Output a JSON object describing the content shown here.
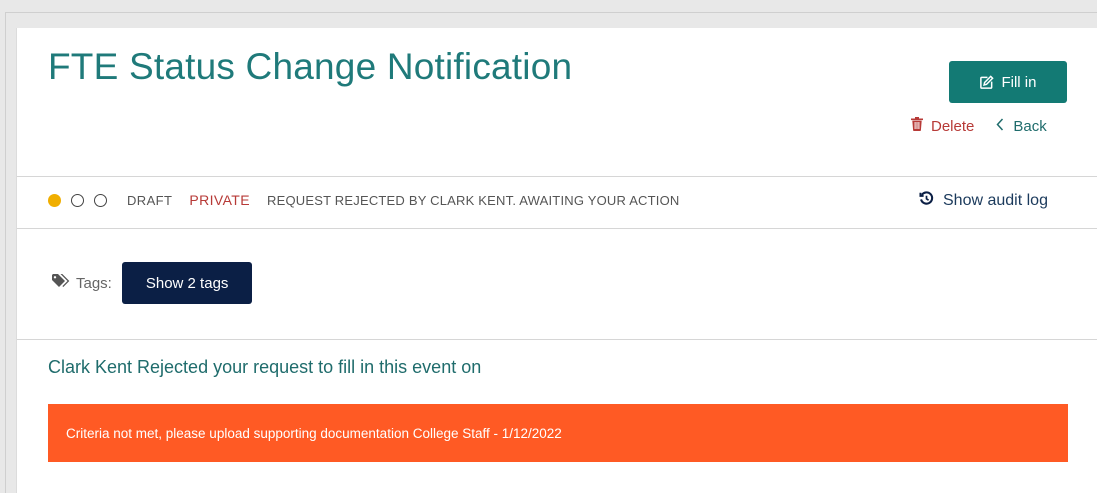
{
  "header": {
    "title": "FTE Status Change Notification",
    "fill_in_label": "Fill in",
    "delete_label": "Delete",
    "back_label": "Back"
  },
  "status": {
    "state": "DRAFT",
    "visibility": "PRIVATE",
    "message": "REQUEST REJECTED BY CLARK KENT. AWAITING YOUR ACTION",
    "audit_label": "Show audit log",
    "progress_steps": [
      "filled",
      "empty",
      "empty"
    ]
  },
  "tags": {
    "label": "Tags:",
    "button_label": "Show 2 tags"
  },
  "rejection": {
    "message": "Clark Kent Rejected your request to fill in this event on",
    "alert_text": "Criteria not met, please upload supporting documentation College Staff - 1/12/2022"
  },
  "colors": {
    "primary": "#137a74",
    "danger": "#b73a37",
    "warning_dot": "#f0ae00",
    "alert_bg": "#ff5a24",
    "tag_button": "#0b1f45"
  },
  "icons": {
    "fill_in": "edit-icon",
    "delete": "trash-icon",
    "back": "chevron-left-icon",
    "audit": "history-icon",
    "tags": "tags-icon"
  }
}
